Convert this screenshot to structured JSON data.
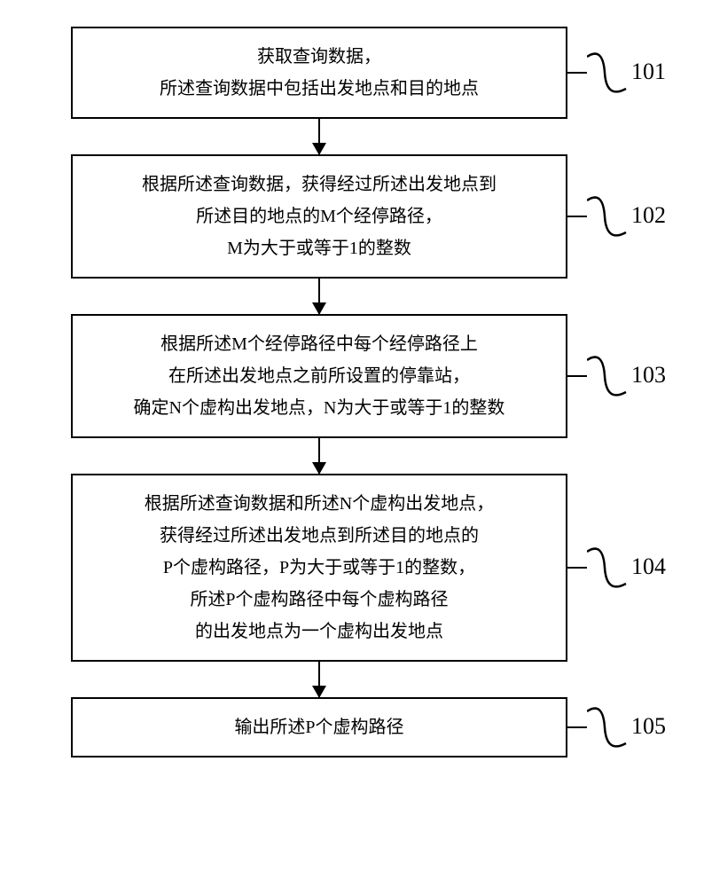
{
  "steps": [
    {
      "id": "101",
      "lines": [
        "获取查询数据，",
        "所述查询数据中包括出发地点和目的地点"
      ]
    },
    {
      "id": "102",
      "lines": [
        "根据所述查询数据，获得经过所述出发地点到",
        "所述目的地点的M个经停路径，",
        "M为大于或等于1的整数"
      ]
    },
    {
      "id": "103",
      "lines": [
        "根据所述M个经停路径中每个经停路径上",
        "在所述出发地点之前所设置的停靠站，",
        "确定N个虚构出发地点，N为大于或等于1的整数"
      ]
    },
    {
      "id": "104",
      "lines": [
        "根据所述查询数据和所述N个虚构出发地点，",
        "获得经过所述出发地点到所述目的地点的",
        "P个虚构路径，P为大于或等于1的整数，",
        "所述P个虚构路径中每个虚构路径",
        "的出发地点为一个虚构出发地点"
      ]
    },
    {
      "id": "105",
      "lines": [
        "输出所述P个虚构路径"
      ]
    }
  ],
  "chart_data": {
    "type": "flowchart",
    "direction": "top-down",
    "nodes": [
      {
        "id": "101",
        "text": "获取查询数据，所述查询数据中包括出发地点和目的地点"
      },
      {
        "id": "102",
        "text": "根据所述查询数据，获得经过所述出发地点到所述目的地点的M个经停路径，M为大于或等于1的整数"
      },
      {
        "id": "103",
        "text": "根据所述M个经停路径中每个经停路径上在所述出发地点之前所设置的停靠站，确定N个虚构出发地点，N为大于或等于1的整数"
      },
      {
        "id": "104",
        "text": "根据所述查询数据和所述N个虚构出发地点，获得经过所述出发地点到所述目的地点的P个虚构路径，P为大于或等于1的整数，所述P个虚构路径中每个虚构路径的出发地点为一个虚构出发地点"
      },
      {
        "id": "105",
        "text": "输出所述P个虚构路径"
      }
    ],
    "edges": [
      {
        "from": "101",
        "to": "102"
      },
      {
        "from": "102",
        "to": "103"
      },
      {
        "from": "103",
        "to": "104"
      },
      {
        "from": "104",
        "to": "105"
      }
    ]
  }
}
